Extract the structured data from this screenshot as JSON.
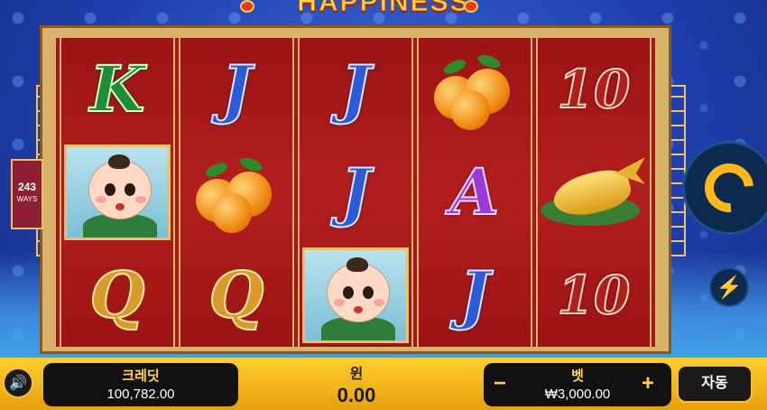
{
  "game": {
    "title": "HAPPINESS"
  },
  "ways": {
    "count": "243",
    "label": "WAYS"
  },
  "reels": [
    [
      "K",
      "baby",
      "Q"
    ],
    [
      "J",
      "orange",
      "Q"
    ],
    [
      "J",
      "J",
      "baby"
    ],
    [
      "orange",
      "A",
      "J"
    ],
    [
      "10",
      "goldfish",
      "10"
    ]
  ],
  "credit": {
    "label": "크레딧",
    "value": "100,782.00"
  },
  "win": {
    "label": "윈",
    "value": "0.00"
  },
  "bet": {
    "label": "벳",
    "value": "₩3,000.00",
    "minus": "−",
    "plus": "+"
  },
  "auto": {
    "label": "자동"
  },
  "icons": {
    "spin": "spin-arrow-icon",
    "turbo": "lightning-icon",
    "sound": "speaker-icon"
  },
  "colors": {
    "accent": "#ffb81a",
    "reel_bg": "#a31717",
    "bar": "#ffcf2e"
  }
}
